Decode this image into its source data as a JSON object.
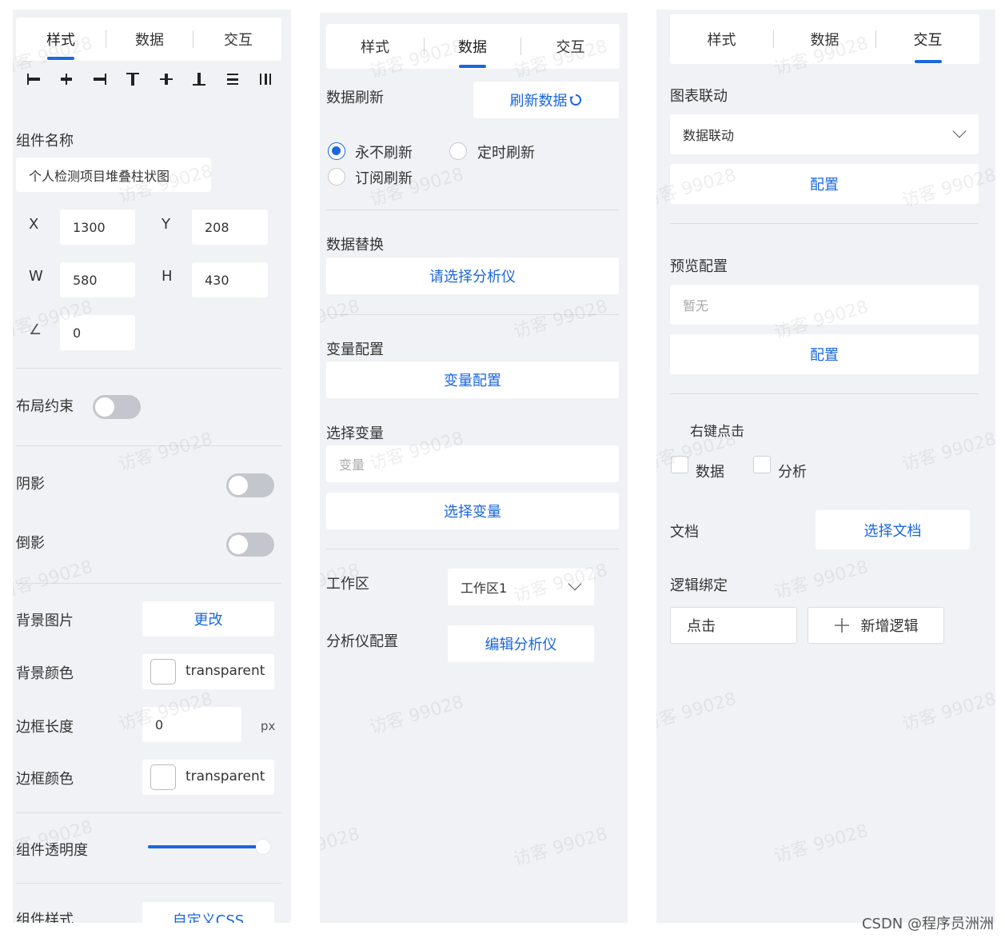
{
  "tabs": {
    "style": "样式",
    "data": "数据",
    "interact": "交互"
  },
  "style_panel": {
    "component_name_label": "组件名称",
    "component_name_value": "个人检测项目堆叠柱状图",
    "x_label": "X",
    "x_value": "1300",
    "y_label": "Y",
    "y_value": "208",
    "w_label": "W",
    "w_value": "580",
    "h_label": "H",
    "h_value": "430",
    "angle_label": "∠",
    "angle_value": "0",
    "layout_constraint_label": "布局约束",
    "shadow_label": "阴影",
    "reflection_label": "倒影",
    "bg_image_label": "背景图片",
    "bg_image_button": "更改",
    "bg_color_label": "背景颜色",
    "bg_color_value": "transparent",
    "border_length_label": "边框长度",
    "border_length_value": "0",
    "border_length_unit": "px",
    "border_color_label": "边框颜色",
    "border_color_value": "transparent",
    "opacity_label": "组件透明度",
    "opacity_value": 0.96,
    "component_style_label": "组件样式",
    "custom_css_button": "自定义CSS"
  },
  "data_panel": {
    "refresh_label": "数据刷新",
    "refresh_button": "刷新数据",
    "radio_never": "永不刷新",
    "radio_timed": "定时刷新",
    "radio_subscribe": "订阅刷新",
    "replace_label": "数据替换",
    "select_analyzer_button": "请选择分析仪",
    "variable_config_label": "变量配置",
    "variable_config_button": "变量配置",
    "select_variable_label": "选择变量",
    "variable_placeholder": "变量",
    "select_variable_button": "选择变量",
    "workspace_label": "工作区",
    "workspace_value": "工作区1",
    "analyzer_config_label": "分析仪配置",
    "edit_analyzer_button": "编辑分析仪"
  },
  "interact_panel": {
    "chart_link_label": "图表联动",
    "chart_link_value": "数据联动",
    "config_button_1": "配置",
    "preview_config_label": "预览配置",
    "preview_placeholder": "暂无",
    "config_button_2": "配置",
    "right_click_label": "右键点击",
    "check_data": "数据",
    "check_analysis": "分析",
    "document_label": "文档",
    "select_document_button": "选择文档",
    "logic_binding_label": "逻辑绑定",
    "click_value": "点击",
    "add_logic_button": "新增逻辑"
  },
  "watermark": "访客 99028",
  "footer": "CSDN @程序员洲洲",
  "colors": {
    "accent": "#1a66e0",
    "panel_bg": "#f0f2f5"
  }
}
